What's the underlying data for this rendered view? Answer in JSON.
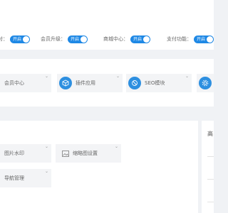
{
  "switches": [
    {
      "label": "付：",
      "state": "开启"
    },
    {
      "label": "会员升级：",
      "state": "开启"
    },
    {
      "label": "商城中心：",
      "state": "开启"
    },
    {
      "label": "支付功能：",
      "state": "开启"
    }
  ],
  "modules": [
    {
      "label": "会员中心",
      "icon": "user-icon"
    },
    {
      "label": "插件应用",
      "icon": "cube-icon"
    },
    {
      "label": "SEO模块",
      "icon": "link-icon"
    },
    {
      "label": "",
      "icon": "gear-icon"
    }
  ],
  "tools": [
    {
      "label": "图片水印"
    },
    {
      "label": "缩略图设置",
      "icon": "image-icon"
    },
    {
      "label": "导航管理"
    }
  ],
  "side_panel": {
    "heading": "高"
  },
  "colors": {
    "accent": "#1e88e5",
    "icon_bg": "#2d8fe0",
    "page_bg": "#f0f2f5"
  }
}
